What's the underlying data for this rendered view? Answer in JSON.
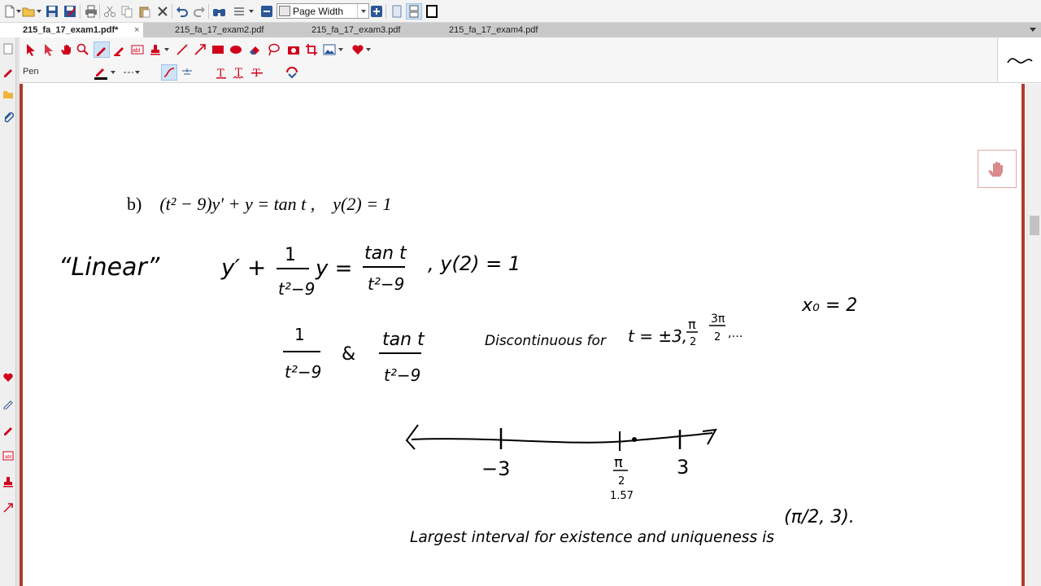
{
  "toolbar": {
    "zoom_value": "Page Width"
  },
  "tabs": [
    {
      "label": "215_fa_17_exam1.pdf*",
      "active": true
    },
    {
      "label": "215_fa_17_exam2.pdf",
      "active": false
    },
    {
      "label": "215_fa_17_exam3.pdf",
      "active": false
    },
    {
      "label": "215_fa_17_exam4.pdf",
      "active": false
    }
  ],
  "annotation_toolbar": {
    "tool_name": "Pen"
  },
  "colors": {
    "pen_accent": "#d0021b",
    "page_border": "#b03a2e",
    "selected_tool_bg": "#cfe3f6"
  },
  "document": {
    "problem": {
      "label": "b)",
      "equation": "(t² − 9)y′ + y = tan t ,",
      "initial_condition": "y(2) = 1"
    },
    "handwriting": {
      "linear": "“Linear”",
      "ode_y": "y′ +",
      "frac1_num": "1",
      "frac1_den": "t²−9",
      "ode_mid": "y =",
      "frac2_num": "tan t",
      "frac2_den": "t²−9",
      "ode_ic": ", y(2) = 1",
      "x0": "x₀ = 2",
      "coef_num": "1",
      "coef_den": "t²−9",
      "and": "&",
      "coef2_num": "tan t",
      "coef2_den": "t²−9",
      "discont": "Discontinuous for",
      "points": "t = ±3,",
      "pi_num": "π",
      "pi_den": "2",
      "pi3_num": "3π",
      "pi3_den": "2",
      "ellipsis": ",…",
      "tick_neg3": "−3",
      "tick_pi": "π",
      "tick_pi_den": "2",
      "tick_pi_val": "1.57",
      "tick_3": "3",
      "conclusion": "Largest interval for existence and uniqueness is",
      "interval": "(π/2, 3)."
    }
  }
}
